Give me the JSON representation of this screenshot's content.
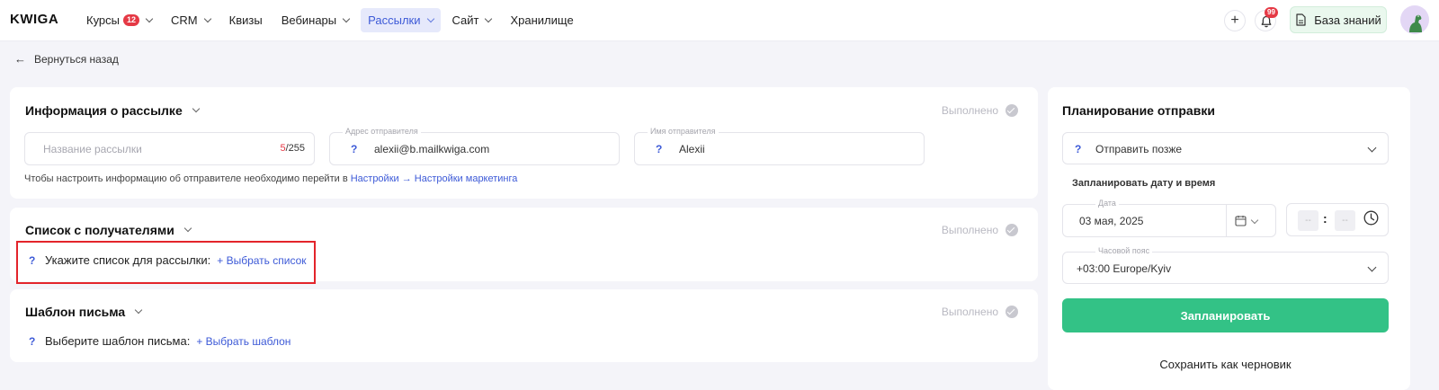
{
  "app": {
    "logo": "KWIGA"
  },
  "nav": {
    "items": [
      {
        "label": "Курсы",
        "badge": "12",
        "dropdown": true
      },
      {
        "label": "CRM",
        "dropdown": true
      },
      {
        "label": "Квизы",
        "dropdown": false
      },
      {
        "label": "Вебинары",
        "dropdown": true
      },
      {
        "label": "Рассылки",
        "dropdown": true,
        "active": true
      },
      {
        "label": "Сайт",
        "dropdown": true
      },
      {
        "label": "Хранилище",
        "dropdown": false
      }
    ]
  },
  "header": {
    "add_icon": "plus-icon",
    "notification_count": "99",
    "knowledge_base_label": "База знаний"
  },
  "back_link": {
    "label": "Вернуться назад"
  },
  "mailing_info": {
    "title": "Информация о рассылке",
    "status": "Выполнено",
    "name_field": {
      "placeholder": "Название рассылки",
      "counter_used": "5",
      "counter_max": "/255"
    },
    "sender_address": {
      "label": "Адрес отправителя",
      "value": "alexii@b.mailkwiga.com"
    },
    "sender_name": {
      "label": "Имя отправителя",
      "value": "Alexii"
    },
    "hint_text": "Чтобы настроить информацию об отправителе необходимо перейти в ",
    "hint_link": "Настройки → Настройки маркетинга"
  },
  "recipients": {
    "title": "Список с получателями",
    "status": "Выполнено",
    "prompt": "Укажите список для рассылки:",
    "action": "+ Выбрать список"
  },
  "template": {
    "title": "Шаблон письма",
    "status": "Выполнено",
    "prompt": "Выберите шаблон письма:",
    "action": "+ Выбрать шаблон"
  },
  "schedule": {
    "title": "Планирование отправки",
    "send_mode": "Отправить позже",
    "datetime_heading": "Запланировать дату и время",
    "date_label": "Дата",
    "date_value": "03 мая, 2025",
    "hour_placeholder": "--",
    "minute_placeholder": "--",
    "time_separator": ":",
    "timezone_label": "Часовой пояс",
    "timezone_value": "+03:00 Europe/Kyiv",
    "schedule_button": "Запланировать",
    "draft_button": "Сохранить как черновик"
  },
  "colors": {
    "accent": "#3d5ad7",
    "success": "#33c286",
    "alert": "#e53945",
    "highlight": "#e3242b"
  }
}
